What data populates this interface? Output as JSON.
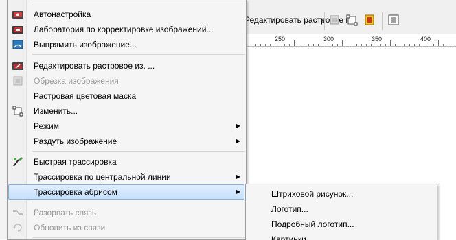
{
  "toolbar": {
    "edit_bitmap_label": "Редактировать растровое из."
  },
  "ruler": {
    "numbers": [
      "250",
      "300",
      "350",
      "400"
    ]
  },
  "menu": {
    "items": [
      {
        "label": "Автонастройка",
        "icon": "autoadjust-icon",
        "disabled": false,
        "submenu": false
      },
      {
        "label": "Лаборатория по корректировке изображений...",
        "icon": "image-lab-icon",
        "disabled": false,
        "submenu": false
      },
      {
        "label": "Выпрямить изображение...",
        "icon": "straighten-icon",
        "disabled": false,
        "submenu": false
      },
      {
        "label": "Редактировать растровое из. ...",
        "icon": "edit-bitmap-icon",
        "disabled": false,
        "submenu": false
      },
      {
        "label": "Обрезка изображения",
        "icon": "crop-icon",
        "disabled": true,
        "submenu": false
      },
      {
        "label": "Растровая цветовая маска",
        "icon": "",
        "disabled": false,
        "submenu": false
      },
      {
        "label": "Изменить...",
        "icon": "resample-icon",
        "disabled": false,
        "submenu": false
      },
      {
        "label": "Режим",
        "icon": "",
        "disabled": false,
        "submenu": true
      },
      {
        "label": "Раздуть изображение",
        "icon": "",
        "disabled": false,
        "submenu": true
      },
      {
        "label": "Быстрая трассировка",
        "icon": "quick-trace-icon",
        "disabled": false,
        "submenu": false
      },
      {
        "label": "Трассировка по центральной линии",
        "icon": "",
        "disabled": false,
        "submenu": true
      },
      {
        "label": "Трассировка абрисом",
        "icon": "",
        "disabled": false,
        "submenu": true,
        "highlighted": true
      },
      {
        "label": "Разорвать связь",
        "icon": "break-link-icon",
        "disabled": true,
        "submenu": false
      },
      {
        "label": "Обновить из связи",
        "icon": "update-link-icon",
        "disabled": true,
        "submenu": false
      }
    ]
  },
  "submenu": {
    "items": [
      {
        "label": "Штриховой рисунок..."
      },
      {
        "label": "Логотип..."
      },
      {
        "label": "Подробный логотип..."
      },
      {
        "label": "Картинки"
      }
    ]
  }
}
